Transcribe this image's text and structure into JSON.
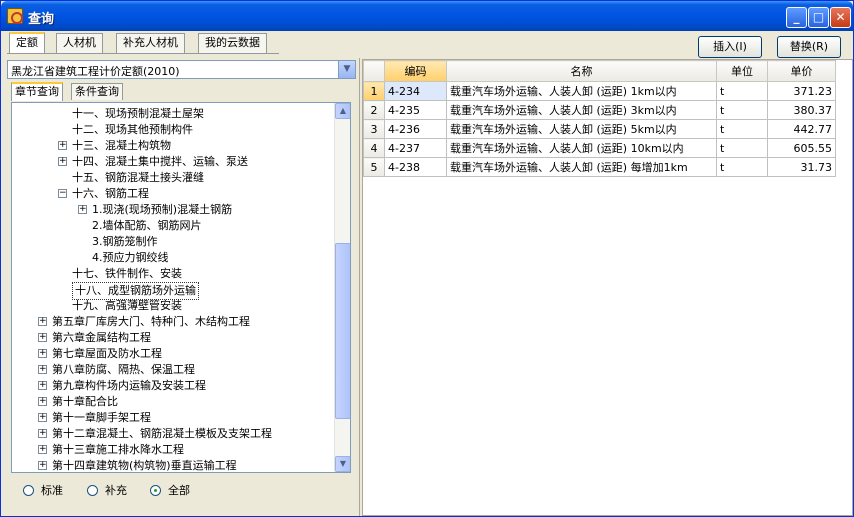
{
  "window": {
    "title": "查询"
  },
  "tabs": [
    "定额",
    "人材机",
    "补充人材机",
    "我的云数据"
  ],
  "buttons": {
    "insert": "插入(I)",
    "replace": "替换(R)"
  },
  "quota_select": {
    "value": "黑龙江省建筑工程计价定额(2010)"
  },
  "sub_tabs": [
    "章节查询",
    "条件查询"
  ],
  "tree": [
    {
      "label": "十一、现场预制混凝土屋架",
      "level": 2,
      "expander": ""
    },
    {
      "label": "十二、现场其他预制构件",
      "level": 2,
      "expander": ""
    },
    {
      "label": "十三、混凝土构筑物",
      "level": 2,
      "expander": "+"
    },
    {
      "label": "十四、混凝土集中搅拌、运输、泵送",
      "level": 2,
      "expander": "+"
    },
    {
      "label": "十五、钢筋混凝土接头灌缝",
      "level": 2,
      "expander": ""
    },
    {
      "label": "十六、钢筋工程",
      "level": 2,
      "expander": "-"
    },
    {
      "label": "1.现浇(现场预制)混凝土钢筋",
      "level": 3,
      "expander": "+"
    },
    {
      "label": "2.墙体配筋、钢筋网片",
      "level": 3,
      "expander": ""
    },
    {
      "label": "3.钢筋笼制作",
      "level": 3,
      "expander": ""
    },
    {
      "label": "4.预应力钢绞线",
      "level": 3,
      "expander": ""
    },
    {
      "label": "十七、铁件制作、安装",
      "level": 2,
      "expander": ""
    },
    {
      "label": "十八、成型钢筋场外运输",
      "level": 2,
      "expander": "",
      "selected": true
    },
    {
      "label": "十九、高强薄壁管安装",
      "level": 2,
      "expander": ""
    },
    {
      "label": "第五章厂库房大门、特种门、木结构工程",
      "level": 1,
      "expander": "+"
    },
    {
      "label": "第六章金属结构工程",
      "level": 1,
      "expander": "+"
    },
    {
      "label": "第七章屋面及防水工程",
      "level": 1,
      "expander": "+"
    },
    {
      "label": "第八章防腐、隔热、保温工程",
      "level": 1,
      "expander": "+"
    },
    {
      "label": "第九章构件场内运输及安装工程",
      "level": 1,
      "expander": "+"
    },
    {
      "label": "第十章配合比",
      "level": 1,
      "expander": "+"
    },
    {
      "label": "第十一章脚手架工程",
      "level": 1,
      "expander": "+"
    },
    {
      "label": "第十二章混凝土、钢筋混凝土模板及支架工程",
      "level": 1,
      "expander": "+"
    },
    {
      "label": "第十三章施工排水降水工程",
      "level": 1,
      "expander": "+"
    },
    {
      "label": "第十四章建筑物(构筑物)垂直运输工程",
      "level": 1,
      "expander": "+"
    }
  ],
  "filter": {
    "options": [
      "标准",
      "补充",
      "全部"
    ],
    "selected": "全部"
  },
  "grid": {
    "columns": [
      "编码",
      "名称",
      "单位",
      "单价"
    ],
    "rows": [
      {
        "no": "1",
        "code": "4-234",
        "name": "载重汽车场外运输、人装人卸 (运距) 1km以内",
        "unit": "t",
        "price": "371.23"
      },
      {
        "no": "2",
        "code": "4-235",
        "name": "载重汽车场外运输、人装人卸 (运距) 3km以内",
        "unit": "t",
        "price": "380.37"
      },
      {
        "no": "3",
        "code": "4-236",
        "name": "载重汽车场外运输、人装人卸 (运距) 5km以内",
        "unit": "t",
        "price": "442.77"
      },
      {
        "no": "4",
        "code": "4-237",
        "name": "载重汽车场外运输、人装人卸 (运距) 10km以内",
        "unit": "t",
        "price": "605.55"
      },
      {
        "no": "5",
        "code": "4-238",
        "name": "载重汽车场外运输、人装人卸 (运距) 每增加1km",
        "unit": "t",
        "price": "31.73"
      }
    ]
  }
}
